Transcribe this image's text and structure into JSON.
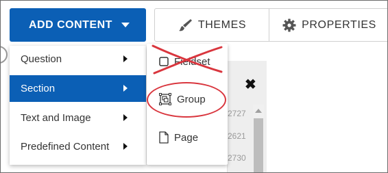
{
  "toolbar": {
    "add_content_label": "ADD CONTENT",
    "caret_icon": "caret-down-icon",
    "themes_label": "THEMES",
    "themes_icon": "paintbrush-icon",
    "properties_label": "PROPERTIES",
    "properties_icon": "gear-icon"
  },
  "menu": {
    "items": [
      {
        "label": "Question",
        "active": false
      },
      {
        "label": "Section",
        "active": true
      },
      {
        "label": "Text and Image",
        "active": false
      },
      {
        "label": "Predefined Content",
        "active": false
      }
    ]
  },
  "submenu": {
    "items": [
      {
        "label": "Fieldset",
        "icon": "checkbox-icon",
        "crossed_out": true
      },
      {
        "label": "Group",
        "icon": "group-icon",
        "circled": true
      },
      {
        "label": "Page",
        "icon": "page-icon"
      }
    ]
  },
  "background": {
    "numbers": [
      "2727",
      "2621",
      "2730"
    ]
  },
  "colors": {
    "accent": "#0b5fb5",
    "annotation": "#d9363e"
  }
}
